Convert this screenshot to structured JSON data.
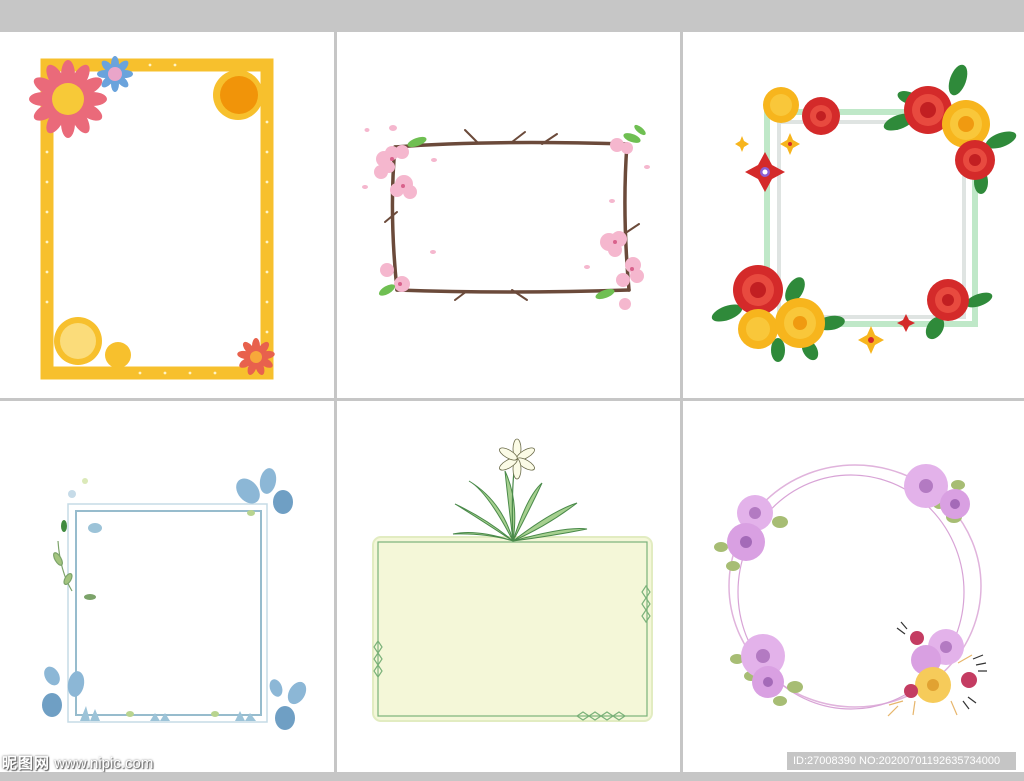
{
  "watermark": {
    "site_name": "昵图网",
    "site_url": "www.nipic.com",
    "id_text": "ID:27008390 NO:20200701192635734000"
  },
  "panels": [
    {
      "theme": "yellow-floral-frame"
    },
    {
      "theme": "cherry-blossom-branch-frame"
    },
    {
      "theme": "paper-rose-frame"
    },
    {
      "theme": "blue-leaf-frame"
    },
    {
      "theme": "lily-label-frame"
    },
    {
      "theme": "watercolor-flower-ring"
    }
  ]
}
